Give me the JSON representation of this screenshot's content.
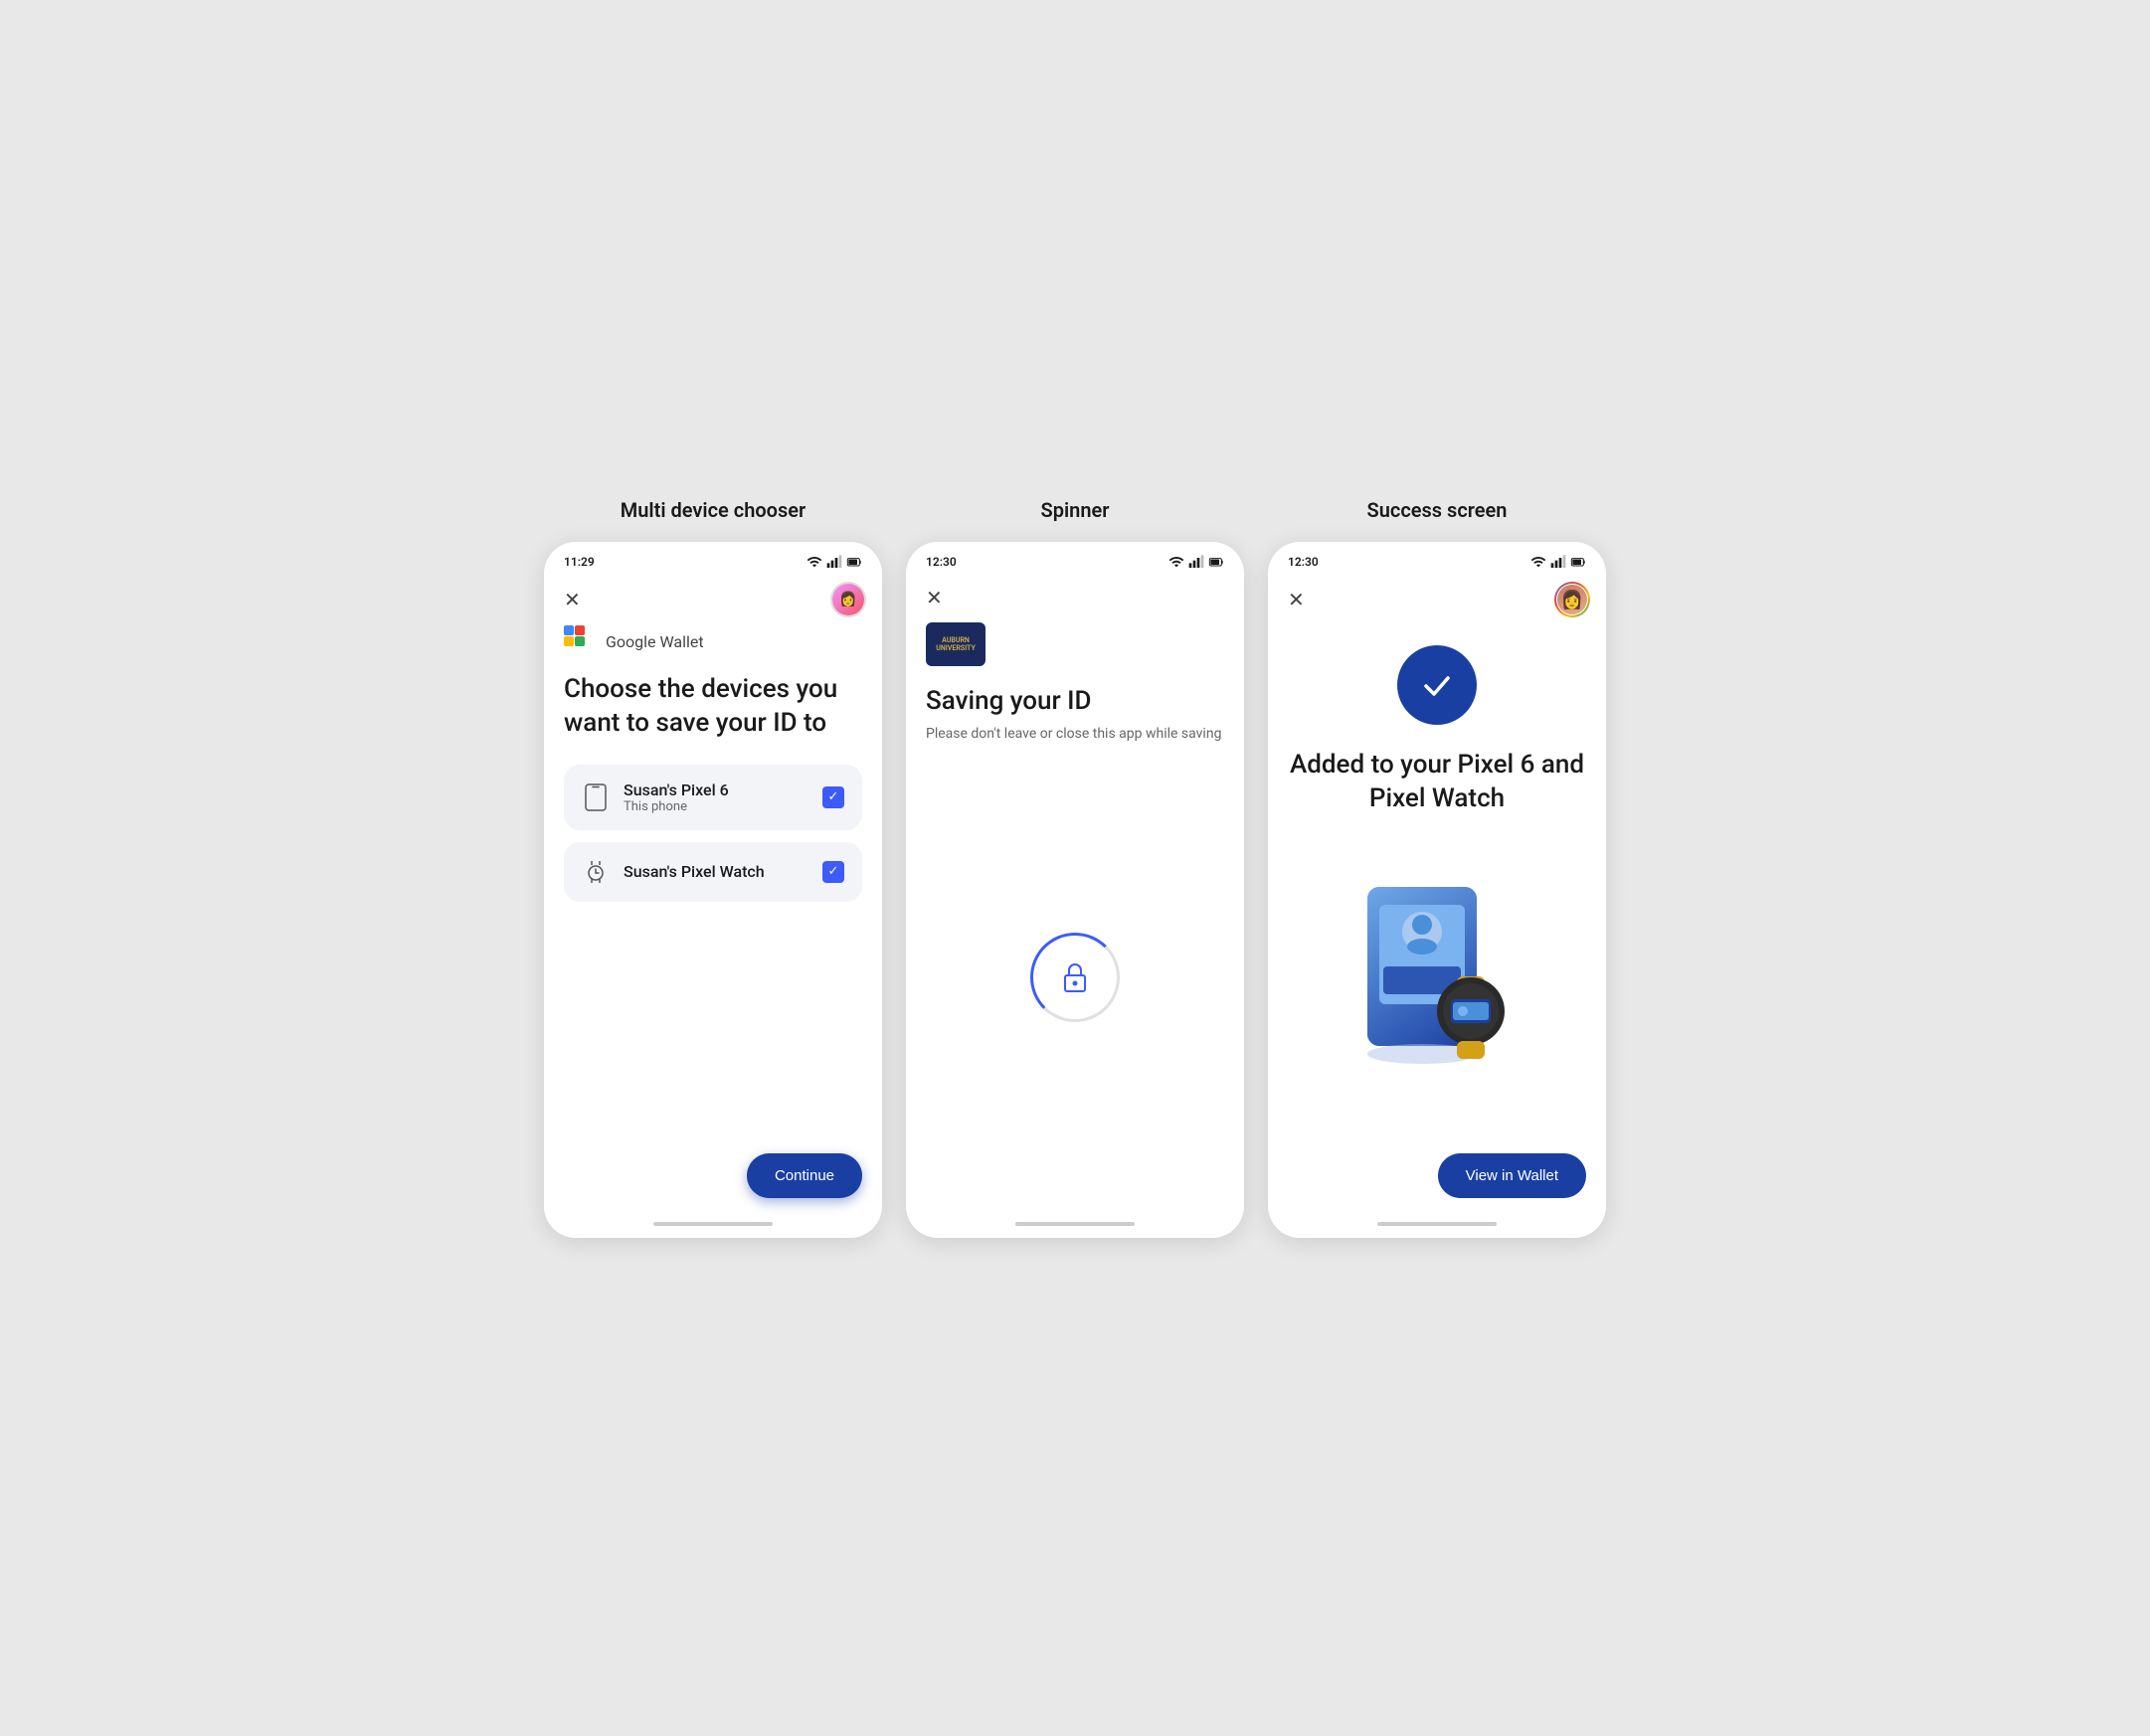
{
  "screen1": {
    "title": "Multi device chooser",
    "status_time": "11:29",
    "heading": "Choose the devices you want to save your ID to",
    "wallet_label": "Google Wallet",
    "devices": [
      {
        "name": "Susan's Pixel 6",
        "sub": "This phone",
        "icon": "phone",
        "checked": true
      },
      {
        "name": "Susan's Pixel Watch",
        "sub": "",
        "icon": "watch",
        "checked": true
      }
    ],
    "continue_label": "Continue"
  },
  "screen2": {
    "title": "Spinner",
    "status_time": "12:30",
    "college_line1": "AUBURN",
    "college_line2": "UNIVERSITY",
    "saving_heading": "Saving your ID",
    "saving_sub": "Please don't leave or close this app while saving"
  },
  "screen3": {
    "title": "Success screen",
    "status_time": "12:30",
    "success_heading": "Added to your Pixel 6 and Pixel Watch",
    "view_wallet_label": "View in Wallet"
  }
}
